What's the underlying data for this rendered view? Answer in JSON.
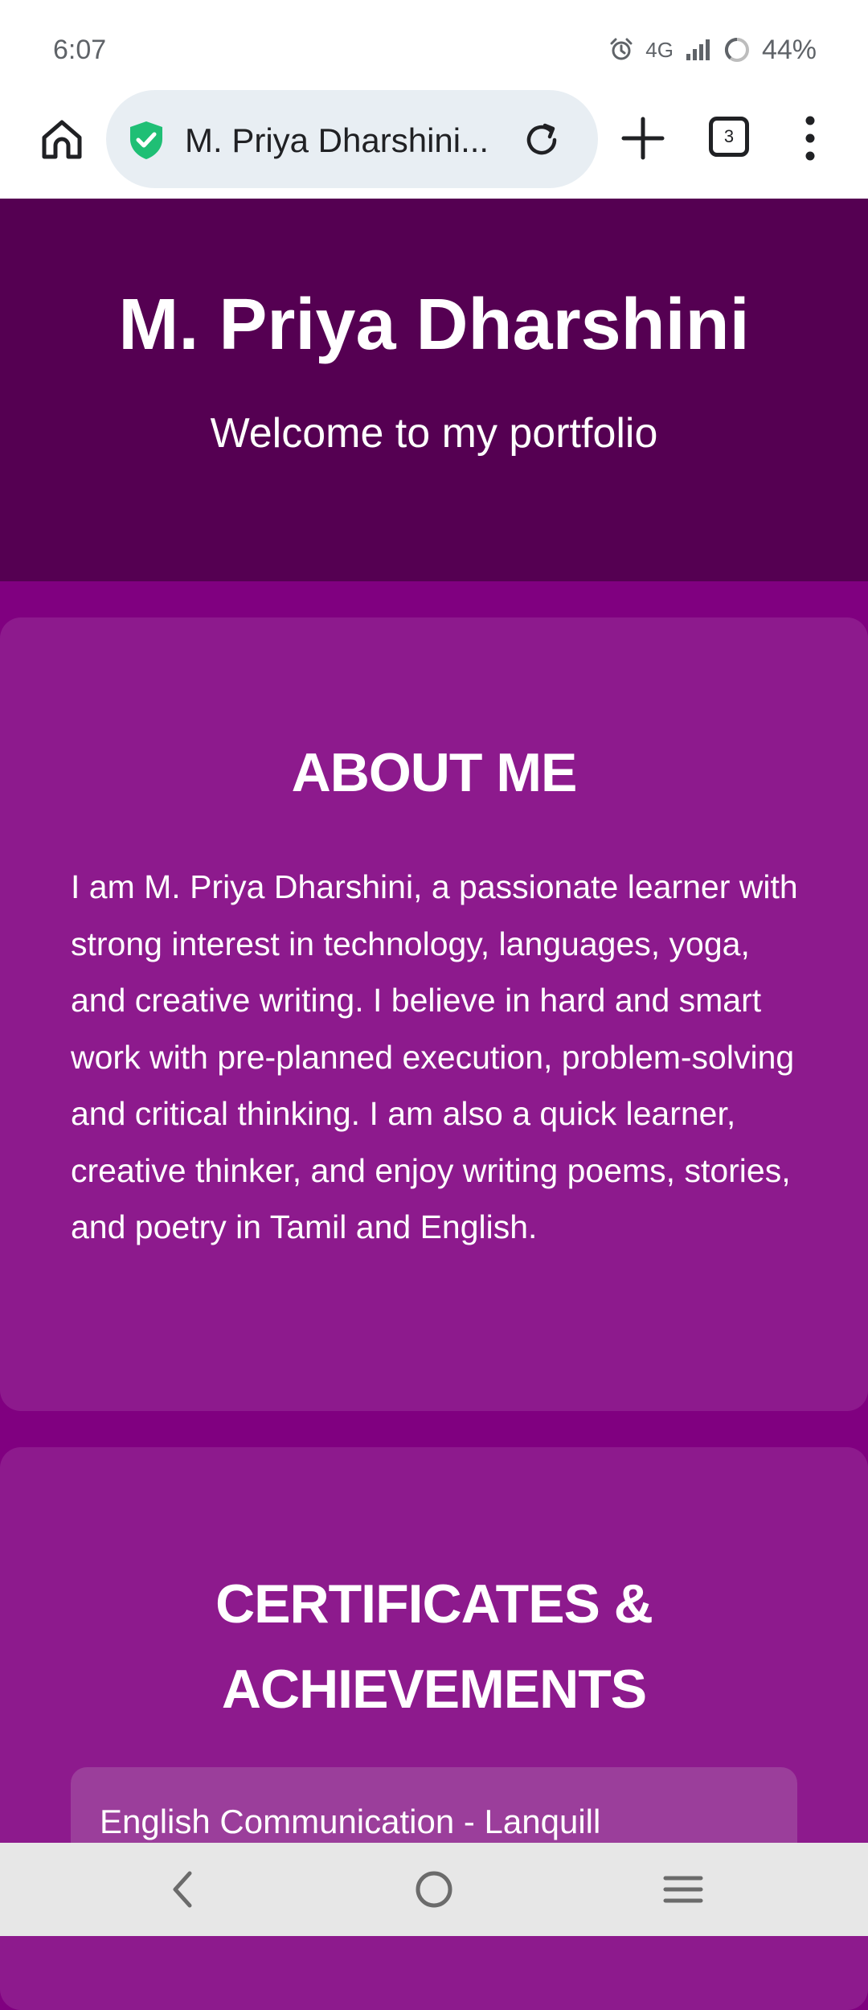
{
  "status_bar": {
    "time": "6:07",
    "network": "4G",
    "battery": "44%",
    "icons": [
      "alarm-icon",
      "signal-icon",
      "battery-icon"
    ]
  },
  "browser": {
    "url_title": "M. Priya Dharshini...",
    "tab_count": "3",
    "icons": [
      "home-icon",
      "shield-check-icon",
      "reload-icon",
      "plus-icon",
      "tabs-icon",
      "more-vert-icon"
    ],
    "shield_color": "#1fbf75"
  },
  "header": {
    "title": "M. Priya Dharshini",
    "subtitle": "Welcome to my portfolio"
  },
  "about": {
    "heading": "ABOUT ME",
    "text": "I am M. Priya Dharshini, a passionate learner with strong interest in technology, languages, yoga, and creative writing. I believe in hard and smart work with pre-planned execution, problem-solving and critical thinking. I am also a quick learner, creative thinker, and enjoy writing poems, stories, and poetry in Tamil and English."
  },
  "certificates": {
    "heading": "CERTIFICATES & ACHIEVEMENTS",
    "items": [
      "English Communication - Lanquill"
    ]
  },
  "nav_bar": {
    "icons": [
      "back-icon",
      "home-circle-icon",
      "recents-icon"
    ]
  },
  "colors": {
    "header_bg": "#550052",
    "page_bg": "#800080",
    "card_bg": "#8d1a8d",
    "item_bg": "#9b3e9b"
  }
}
